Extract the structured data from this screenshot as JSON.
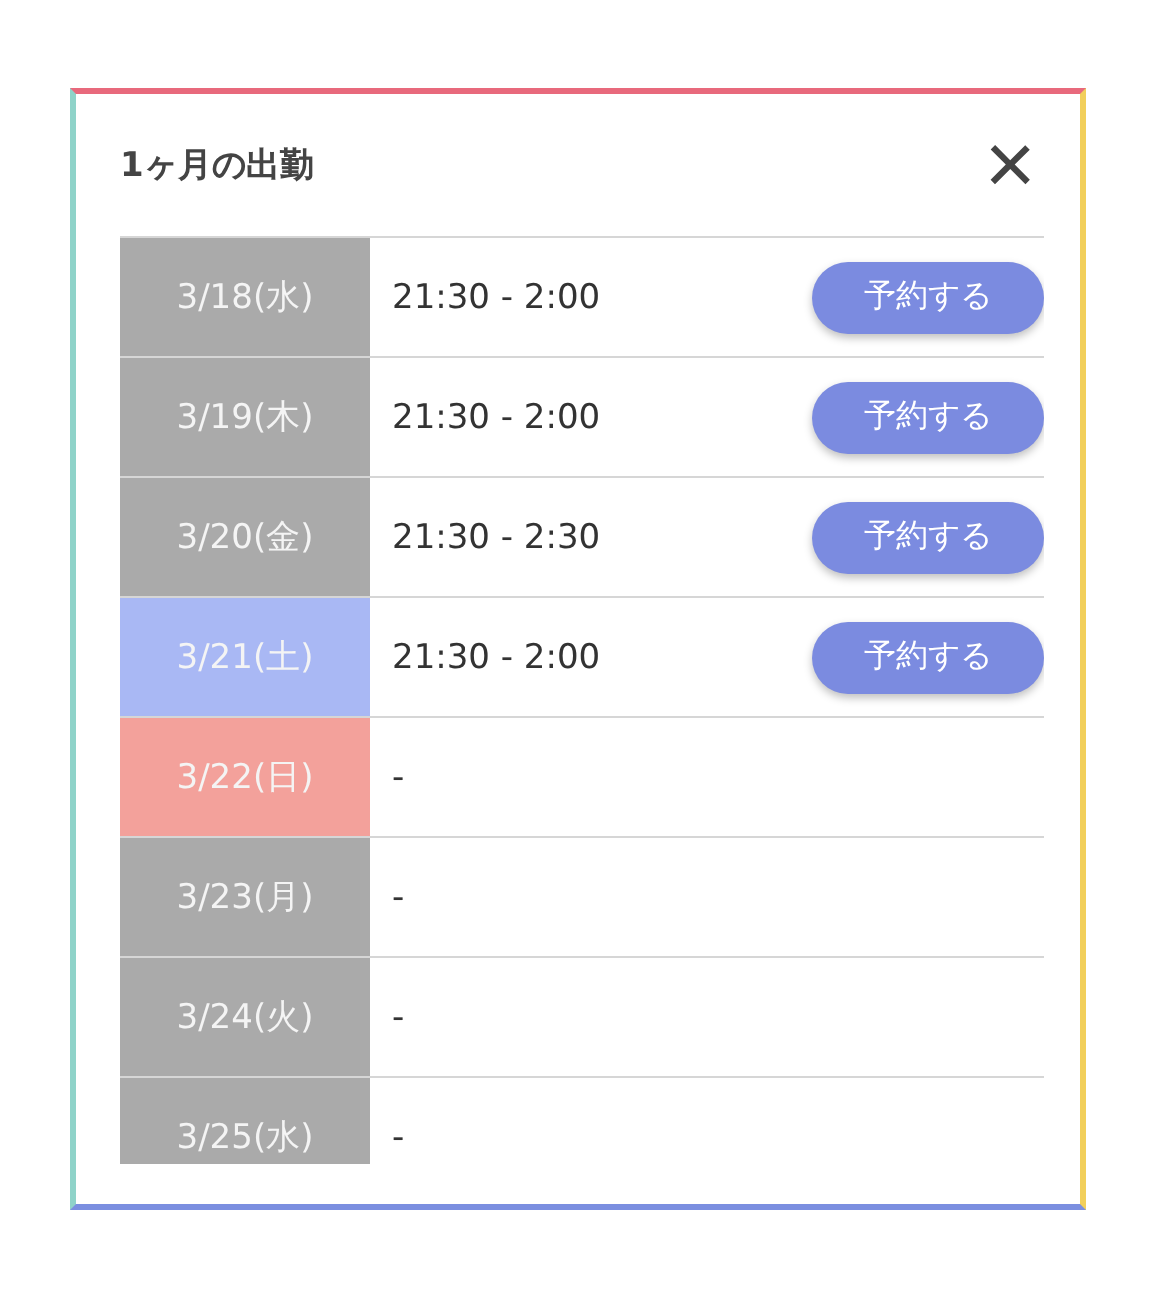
{
  "dialog": {
    "title": "1ヶ月の出勤",
    "close": "×"
  },
  "schedule": [
    {
      "date": "3/18(水)",
      "kind": "weekday",
      "hours": "21:30 - 2:00",
      "button": "予約する"
    },
    {
      "date": "3/19(木)",
      "kind": "weekday",
      "hours": "21:30 - 2:00",
      "button": "予約する"
    },
    {
      "date": "3/20(金)",
      "kind": "weekday",
      "hours": "21:30 - 2:30",
      "button": "予約する"
    },
    {
      "date": "3/21(土)",
      "kind": "saturday",
      "hours": "21:30 - 2:00",
      "button": "予約する"
    },
    {
      "date": "3/22(日)",
      "kind": "sunday",
      "hours": "-"
    },
    {
      "date": "3/23(月)",
      "kind": "weekday",
      "hours": "-"
    },
    {
      "date": "3/24(火)",
      "kind": "weekday",
      "hours": "-"
    },
    {
      "date": "3/25(水)",
      "kind": "weekday",
      "hours": "-"
    }
  ]
}
